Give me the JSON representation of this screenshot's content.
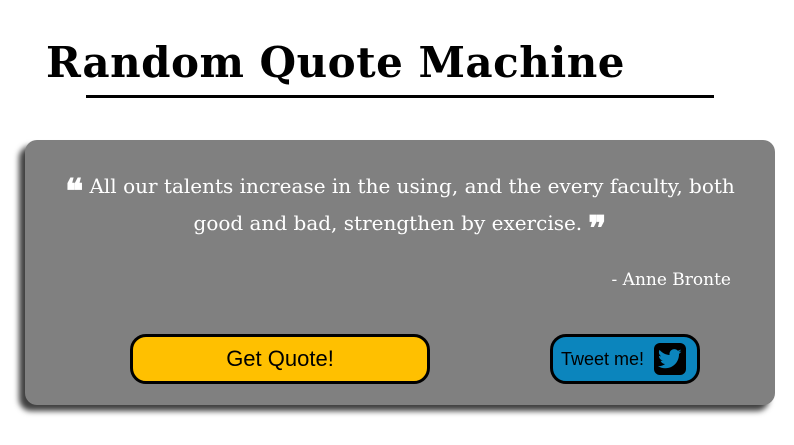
{
  "header": {
    "title": "Random Quote Machine"
  },
  "quote": {
    "open_mark": "❝",
    "text": "All our talents increase in the using, and the every faculty, both good and bad, strengthen by exercise.",
    "close_mark": "❞",
    "author": "- Anne Bronte"
  },
  "actions": {
    "get_quote_label": "Get Quote!",
    "tweet_label": "Tweet me!",
    "tweet_icon": "twitter-icon"
  },
  "colors": {
    "card_background": "#808080",
    "get_quote_button": "#ffc000",
    "tweet_button": "#0b85bd",
    "text_on_card": "#ffffff"
  }
}
